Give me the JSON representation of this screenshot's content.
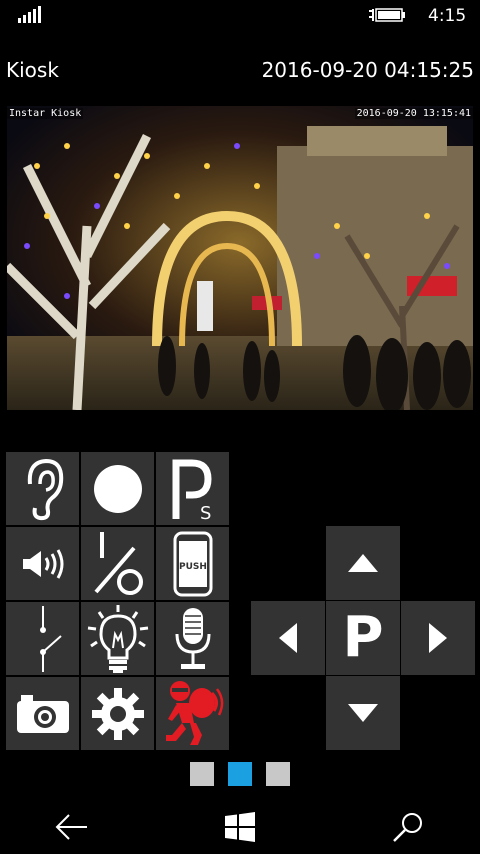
{
  "status": {
    "time": "4:15",
    "signal_icon": "signal-bars-icon",
    "battery_icon": "battery-charging-icon"
  },
  "header": {
    "title": "Kiosk",
    "datetime": "2016-09-20 04:15:25"
  },
  "camera": {
    "osd_name": "Instar Kiosk",
    "osd_time": "2016-09-20 13:15:41"
  },
  "controls": [
    {
      "name": "audio-listen-button",
      "icon": "ear-icon"
    },
    {
      "name": "record-button",
      "icon": "record-circle-icon"
    },
    {
      "name": "parking-position-button",
      "icon": "parking-s-icon"
    },
    {
      "name": "speaker-button",
      "icon": "speaker-icon"
    },
    {
      "name": "io-toggle-button",
      "icon": "slash-io-icon"
    },
    {
      "name": "push-notification-button",
      "icon": "phone-push-icon"
    },
    {
      "name": "alarm-switch-button",
      "icon": "switch-icon"
    },
    {
      "name": "night-light-button",
      "icon": "bulb-icon"
    },
    {
      "name": "microphone-button",
      "icon": "microphone-icon"
    },
    {
      "name": "snapshot-button",
      "icon": "camera-icon"
    },
    {
      "name": "settings-button",
      "icon": "gear-icon"
    },
    {
      "name": "alarm-burglar-button",
      "icon": "burglar-icon"
    }
  ],
  "ptz": {
    "center_label": "P",
    "up_icon": "triangle-up-icon",
    "down_icon": "triangle-down-icon",
    "left_icon": "triangle-left-icon",
    "right_icon": "triangle-right-icon"
  },
  "page_indicator": {
    "count": 3,
    "active_index": 1
  },
  "colors": {
    "accent": "#1ba1e2",
    "button_bg": "#333333",
    "alarm_red": "#e31b23"
  }
}
